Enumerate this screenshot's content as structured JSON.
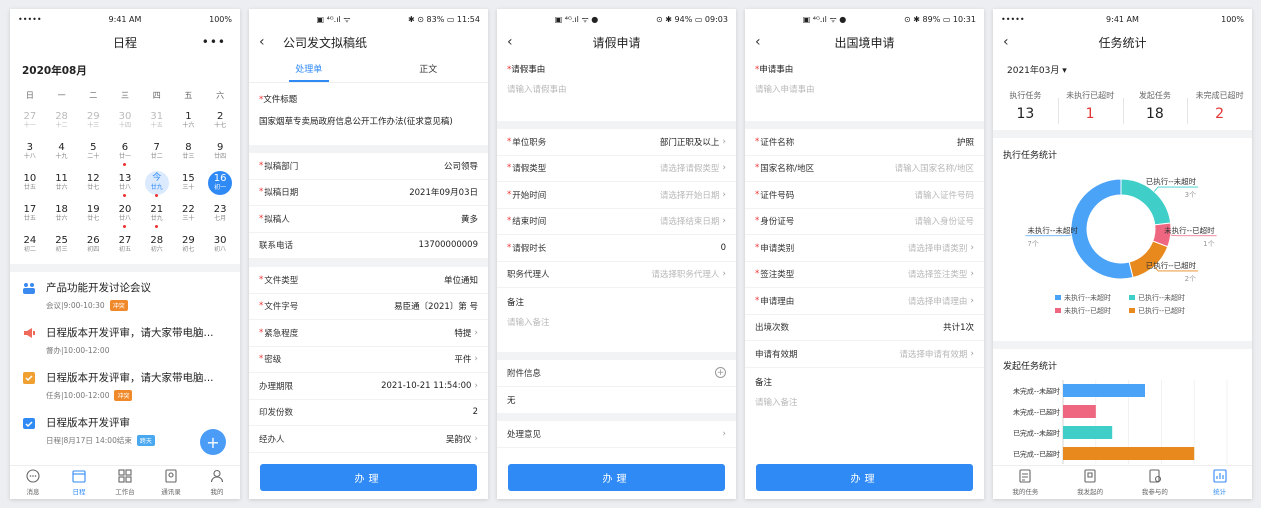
{
  "colors": {
    "accent": "#2f8af5",
    "required": "#e33333",
    "unexceeded_blue": "#4aa3f7",
    "done_teal": "#3fcfc8",
    "exceeded_pink": "#ee6680",
    "done_exceeded_orange": "#e8891e"
  },
  "s1": {
    "status": {
      "left": "••••• ",
      "time": "9:41 AM",
      "right": "100%"
    },
    "title": "日程",
    "more": "•••",
    "month": "2020年08月",
    "weekdays": [
      "日",
      "一",
      "二",
      "三",
      "四",
      "五",
      "六"
    ],
    "days": [
      {
        "n": "27",
        "l": "十一",
        "dim": true
      },
      {
        "n": "28",
        "l": "十二",
        "dim": true
      },
      {
        "n": "29",
        "l": "十三",
        "dim": true
      },
      {
        "n": "30",
        "l": "十四",
        "dim": true
      },
      {
        "n": "31",
        "l": "十五",
        "dim": true
      },
      {
        "n": "1",
        "l": "十六"
      },
      {
        "n": "2",
        "l": "十七"
      },
      {
        "n": "3",
        "l": "十八"
      },
      {
        "n": "4",
        "l": "十九"
      },
      {
        "n": "5",
        "l": "二十"
      },
      {
        "n": "6",
        "l": "廿一",
        "dot": true
      },
      {
        "n": "7",
        "l": "廿二"
      },
      {
        "n": "8",
        "l": "廿三"
      },
      {
        "n": "9",
        "l": "廿四"
      },
      {
        "n": "10",
        "l": "廿五"
      },
      {
        "n": "11",
        "l": "廿六"
      },
      {
        "n": "12",
        "l": "廿七"
      },
      {
        "n": "13",
        "l": "廿八",
        "dot": true
      },
      {
        "n": "今",
        "l": "廿九",
        "today": true,
        "dot": true
      },
      {
        "n": "15",
        "l": "三十"
      },
      {
        "n": "16",
        "l": "初一",
        "sel": true
      },
      {
        "n": "17",
        "l": "廿五"
      },
      {
        "n": "18",
        "l": "廿六"
      },
      {
        "n": "19",
        "l": "廿七"
      },
      {
        "n": "20",
        "l": "廿八",
        "dot": true
      },
      {
        "n": "21",
        "l": "廿九",
        "dot": true
      },
      {
        "n": "22",
        "l": "三十"
      },
      {
        "n": "23",
        "l": "七月"
      },
      {
        "n": "24",
        "l": "初二"
      },
      {
        "n": "25",
        "l": "初三"
      },
      {
        "n": "26",
        "l": "初四"
      },
      {
        "n": "27",
        "l": "初五"
      },
      {
        "n": "28",
        "l": "初六"
      },
      {
        "n": "29",
        "l": "初七"
      },
      {
        "n": "30",
        "l": "初八"
      }
    ],
    "events": [
      {
        "icon": "meeting-icon",
        "title": "产品功能开发讨论会议",
        "type": "会议",
        "time": "9:00-10:30",
        "tag": "冲突",
        "tagColor": "#f0892a"
      },
      {
        "icon": "megaphone-icon",
        "title": "日程版本开发评审，请大家带电脑...",
        "type": "督办",
        "time": "10:00-12:00",
        "tag": "",
        "tagColor": ""
      },
      {
        "icon": "task-check-icon",
        "title": "日程版本开发评审，请大家带电脑...",
        "type": "任务",
        "time": "10:00-12:00",
        "tag": "冲突",
        "tagColor": "#f0892a"
      },
      {
        "icon": "calendar-check-icon",
        "title": "日程版本开发评审",
        "type": "日程",
        "time": "8月17日 14:00结束",
        "tag": "跨天",
        "tagColor": "#4aa8f0"
      }
    ],
    "fab": "+",
    "tabs": [
      "消息",
      "日程",
      "工作台",
      "通讯录",
      "我的"
    ]
  },
  "s2": {
    "status": {
      "center": "▣ ⁴ᴳ.ıl ᯤ",
      "right": "✱ ⊙ 83% ▭ 11:54"
    },
    "title": "公司发文拟稿纸",
    "tabs": [
      "处理单",
      "正文"
    ],
    "doc_label": "文件标题",
    "doc_title": "国家烟草专卖局政府信息公开工作办法(征求意见稿)",
    "group1": [
      {
        "label": "拟稿部门",
        "value": "公司领导",
        "req": true
      },
      {
        "label": "拟稿日期",
        "value": "2021年09月03日",
        "req": true
      },
      {
        "label": "拟稿人",
        "value": "黄多",
        "req": true
      },
      {
        "label": "联系电话",
        "value": "13700000009",
        "req": false
      }
    ],
    "group2": [
      {
        "label": "文件类型",
        "value": "单位通知",
        "req": true,
        "chev": false
      },
      {
        "label": "文件字号",
        "value": "易臣通〔2021〕第 号",
        "req": true,
        "chev": false
      },
      {
        "label": "紧急程度",
        "value": "特提",
        "req": true,
        "chev": true
      },
      {
        "label": "密级",
        "value": "平件",
        "req": true,
        "chev": true
      },
      {
        "label": "办理期限",
        "value": "2021-10-21 11:54:00",
        "req": false,
        "chev": true
      },
      {
        "label": "印发份数",
        "value": "2",
        "req": false,
        "chev": false
      },
      {
        "label": "经办人",
        "value": "吴韵仪",
        "req": false,
        "chev": true
      }
    ],
    "button": "办理"
  },
  "s3": {
    "status": {
      "center": "▣ ⁴ᴳ.ıl ᯤ ●",
      "right": "⊙ ✱ 94% ▭ 09:03"
    },
    "title": "请假申请",
    "reason_label": "请假事由",
    "reason_ph": "请输入请假事由",
    "rows": [
      {
        "label": "单位职务",
        "value": "部门正职及以上",
        "ph": false,
        "req": true
      },
      {
        "label": "请假类型",
        "value": "请选择请假类型",
        "ph": true,
        "req": true
      },
      {
        "label": "开始时间",
        "value": "请选择开始日期",
        "ph": true,
        "req": true
      },
      {
        "label": "结束时间",
        "value": "请选择结束日期",
        "ph": true,
        "req": true
      },
      {
        "label": "请假时长",
        "value": "0",
        "ph": false,
        "req": true,
        "nochev": true
      },
      {
        "label": "职务代理人",
        "value": "请选择职务代理人",
        "ph": true,
        "req": false
      }
    ],
    "remark_label": "备注",
    "remark_ph": "请输入备注",
    "attach_label": "附件信息",
    "attach_value": "无",
    "opinion_label": "处理意见",
    "button": "办理"
  },
  "s4": {
    "status": {
      "center": "▣ ⁴ᴳ.ıl ᯤ ●",
      "right": "⊙ ✱ 89% ▭ 10:31"
    },
    "title": "出国境申请",
    "reason_label": "申请事由",
    "reason_ph": "请输入申请事由",
    "rows": [
      {
        "label": "证件名称",
        "value": "护照",
        "ph": false,
        "req": true,
        "chev": false
      },
      {
        "label": "国家名称/地区",
        "value": "请输入国家名称/地区",
        "ph": true,
        "req": true,
        "chev": false
      },
      {
        "label": "证件号码",
        "value": "请输入证件号码",
        "ph": true,
        "req": true,
        "chev": false
      },
      {
        "label": "身份证号",
        "value": "请输入身份证号",
        "ph": true,
        "req": true,
        "chev": false
      },
      {
        "label": "申请类别",
        "value": "请选择申请类别",
        "ph": true,
        "req": true,
        "chev": true
      },
      {
        "label": "签注类型",
        "value": "请选择签注类型",
        "ph": true,
        "req": true,
        "chev": true
      },
      {
        "label": "申请理由",
        "value": "请选择申请理由",
        "ph": true,
        "req": true,
        "chev": true
      },
      {
        "label": "出境次数",
        "value": "共计1次",
        "ph": false,
        "req": false,
        "chev": false
      },
      {
        "label": "申请有效期",
        "value": "请选择申请有效期",
        "ph": true,
        "req": false,
        "chev": true
      }
    ],
    "remark_label": "备注",
    "remark_ph": "请输入备注",
    "button": "办理"
  },
  "s5": {
    "status": {
      "left": "••••• ",
      "time": "9:41 AM",
      "right": "100%"
    },
    "title": "任务统计",
    "month": "2021年03月 ▾",
    "stats": [
      {
        "k": "执行任务",
        "v": "13",
        "red": false
      },
      {
        "k": "未执行已超时",
        "v": "1",
        "red": true
      },
      {
        "k": "发起任务",
        "v": "18",
        "red": false
      },
      {
        "k": "未完成已超时",
        "v": "2",
        "red": true
      }
    ],
    "donut_title": "执行任务统计",
    "bar_title": "发起任务统计",
    "tabs": [
      "我的任务",
      "我发起的",
      "我参与的",
      "统计"
    ]
  },
  "chart_data": [
    {
      "type": "pie",
      "title": "执行任务统计",
      "slices": [
        {
          "name": "未执行--未超时",
          "value": 7,
          "label": "7个",
          "color": "#4aa3f7"
        },
        {
          "name": "已执行--未超时",
          "value": 3,
          "label": "3个",
          "color": "#3fcfc8"
        },
        {
          "name": "未执行--已超时",
          "value": 1,
          "label": "1个",
          "color": "#ee6680"
        },
        {
          "name": "已执行--已超时",
          "value": 2,
          "label": "2个",
          "color": "#e8891e"
        }
      ],
      "legend": [
        "未执行--未超时",
        "已执行--未超时",
        "未执行--已超时",
        "已执行--已超时"
      ],
      "legend_placement": "bottom"
    },
    {
      "type": "bar",
      "orientation": "horizontal",
      "title": "发起任务统计",
      "categories": [
        "未完成--未超时",
        "未完成--已超时",
        "已完成--未超时",
        "已完成--已超时"
      ],
      "values": [
        5,
        2,
        3,
        8
      ],
      "colors": [
        "#4aa3f7",
        "#ee6680",
        "#3fcfc8",
        "#e8891e"
      ],
      "xlim": [
        0,
        10
      ],
      "xticks": [
        "0",
        "2",
        "4",
        "6",
        "8",
        "10"
      ],
      "grid": true
    }
  ]
}
